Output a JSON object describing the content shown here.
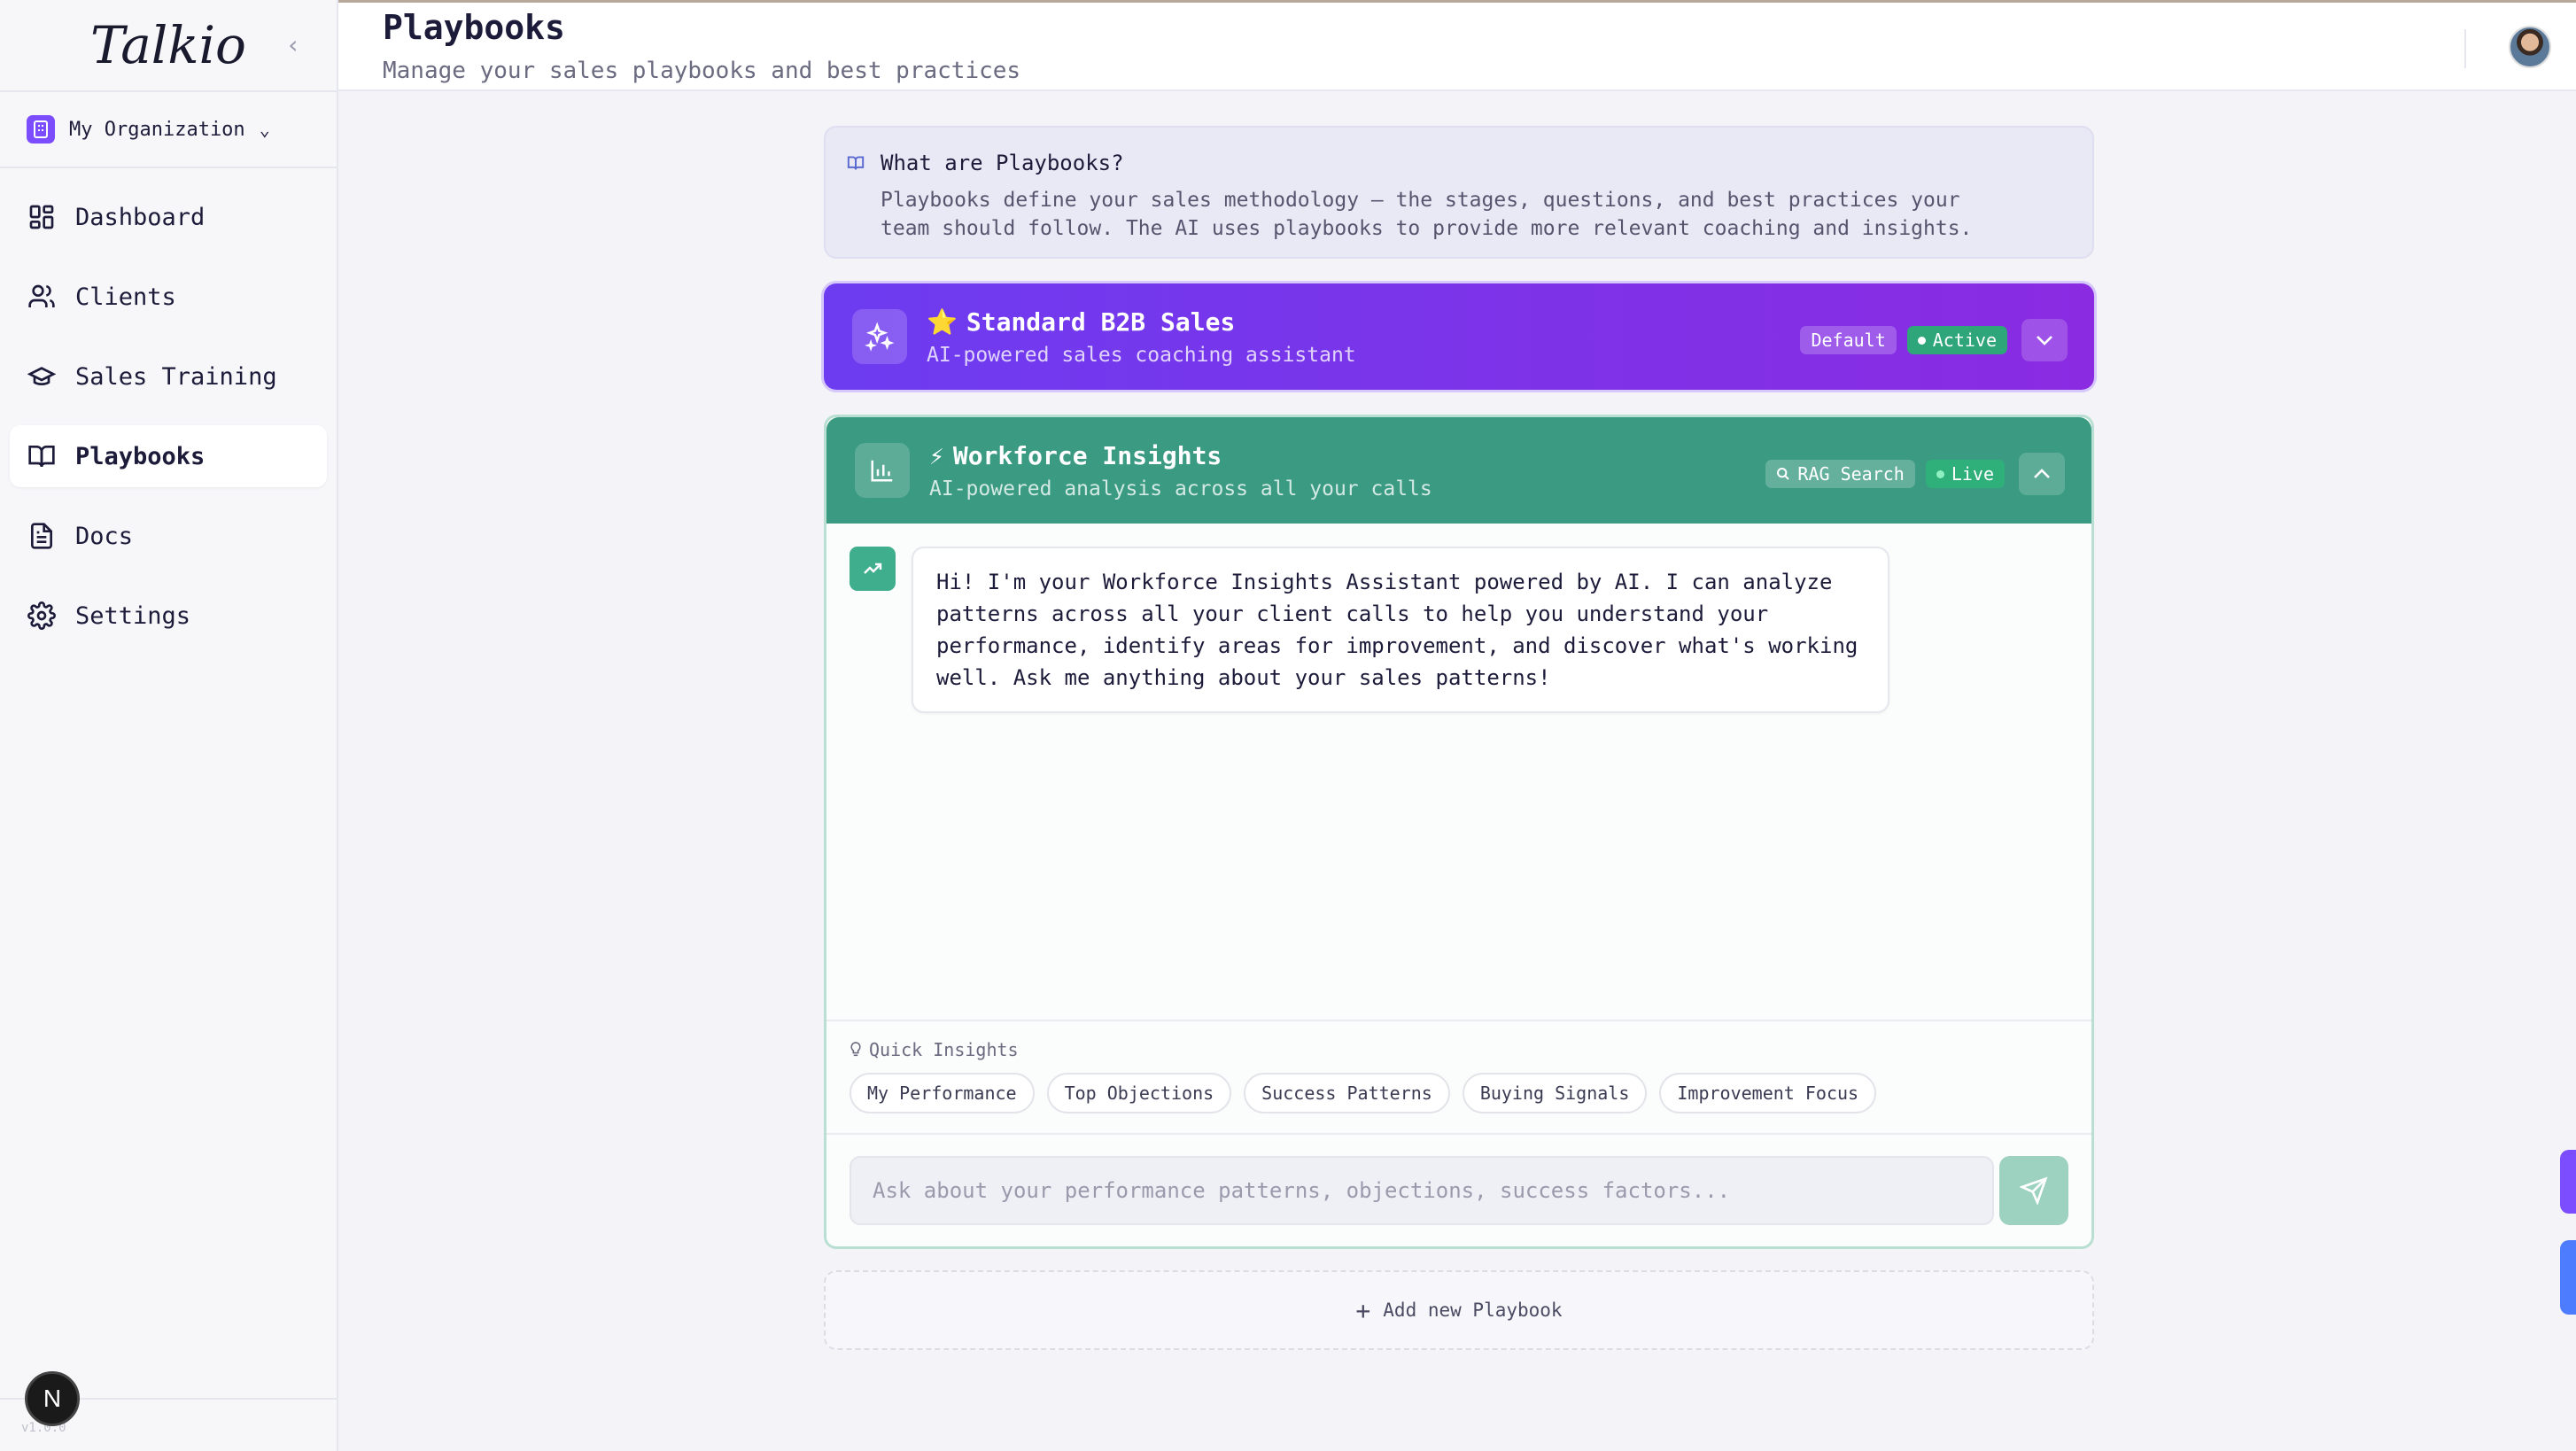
{
  "app": {
    "brand": "Talkio",
    "version": "v1.0.0"
  },
  "org": {
    "name": "My Organization"
  },
  "nav": [
    {
      "label": "Dashboard",
      "icon": "dashboard-icon"
    },
    {
      "label": "Clients",
      "icon": "users-icon"
    },
    {
      "label": "Sales Training",
      "icon": "graduation-cap-icon"
    },
    {
      "label": "Playbooks",
      "icon": "book-icon",
      "active": true
    },
    {
      "label": "Docs",
      "icon": "document-icon"
    },
    {
      "label": "Settings",
      "icon": "gear-icon"
    }
  ],
  "header": {
    "title": "Playbooks",
    "subtitle": "Manage your sales playbooks and best practices"
  },
  "info": {
    "title": "What are Playbooks?",
    "body": "Playbooks define your sales methodology — the stages, questions, and best practices your team should follow. The AI uses playbooks to provide more relevant coaching and insights."
  },
  "playbooks": [
    {
      "emoji": "⭐",
      "title": "Standard B2B Sales",
      "subtitle": "AI-powered sales coaching assistant",
      "badges": [
        "Default",
        "Active"
      ]
    },
    {
      "emoji": "⚡",
      "title": "Workforce Insights",
      "subtitle": "AI-powered analysis across all your calls",
      "badges": [
        "RAG Search",
        "Live"
      ]
    }
  ],
  "chat": {
    "greeting": "Hi! I'm your Workforce Insights Assistant powered by AI. I can analyze patterns across all your client calls to help you understand your performance, identify areas for improvement, and discover what's working well. Ask me anything about your sales patterns!",
    "quick_insights_label": "Quick Insights",
    "chips": [
      "My Performance",
      "Top Objections",
      "Success Patterns",
      "Buying Signals",
      "Improvement Focus"
    ],
    "input_placeholder": "Ask about your performance patterns, objections, success factors..."
  },
  "add_playbook_label": "Add new Playbook",
  "colors": {
    "accent_purple": "#7c4dff",
    "accent_green": "#3a9a82"
  }
}
